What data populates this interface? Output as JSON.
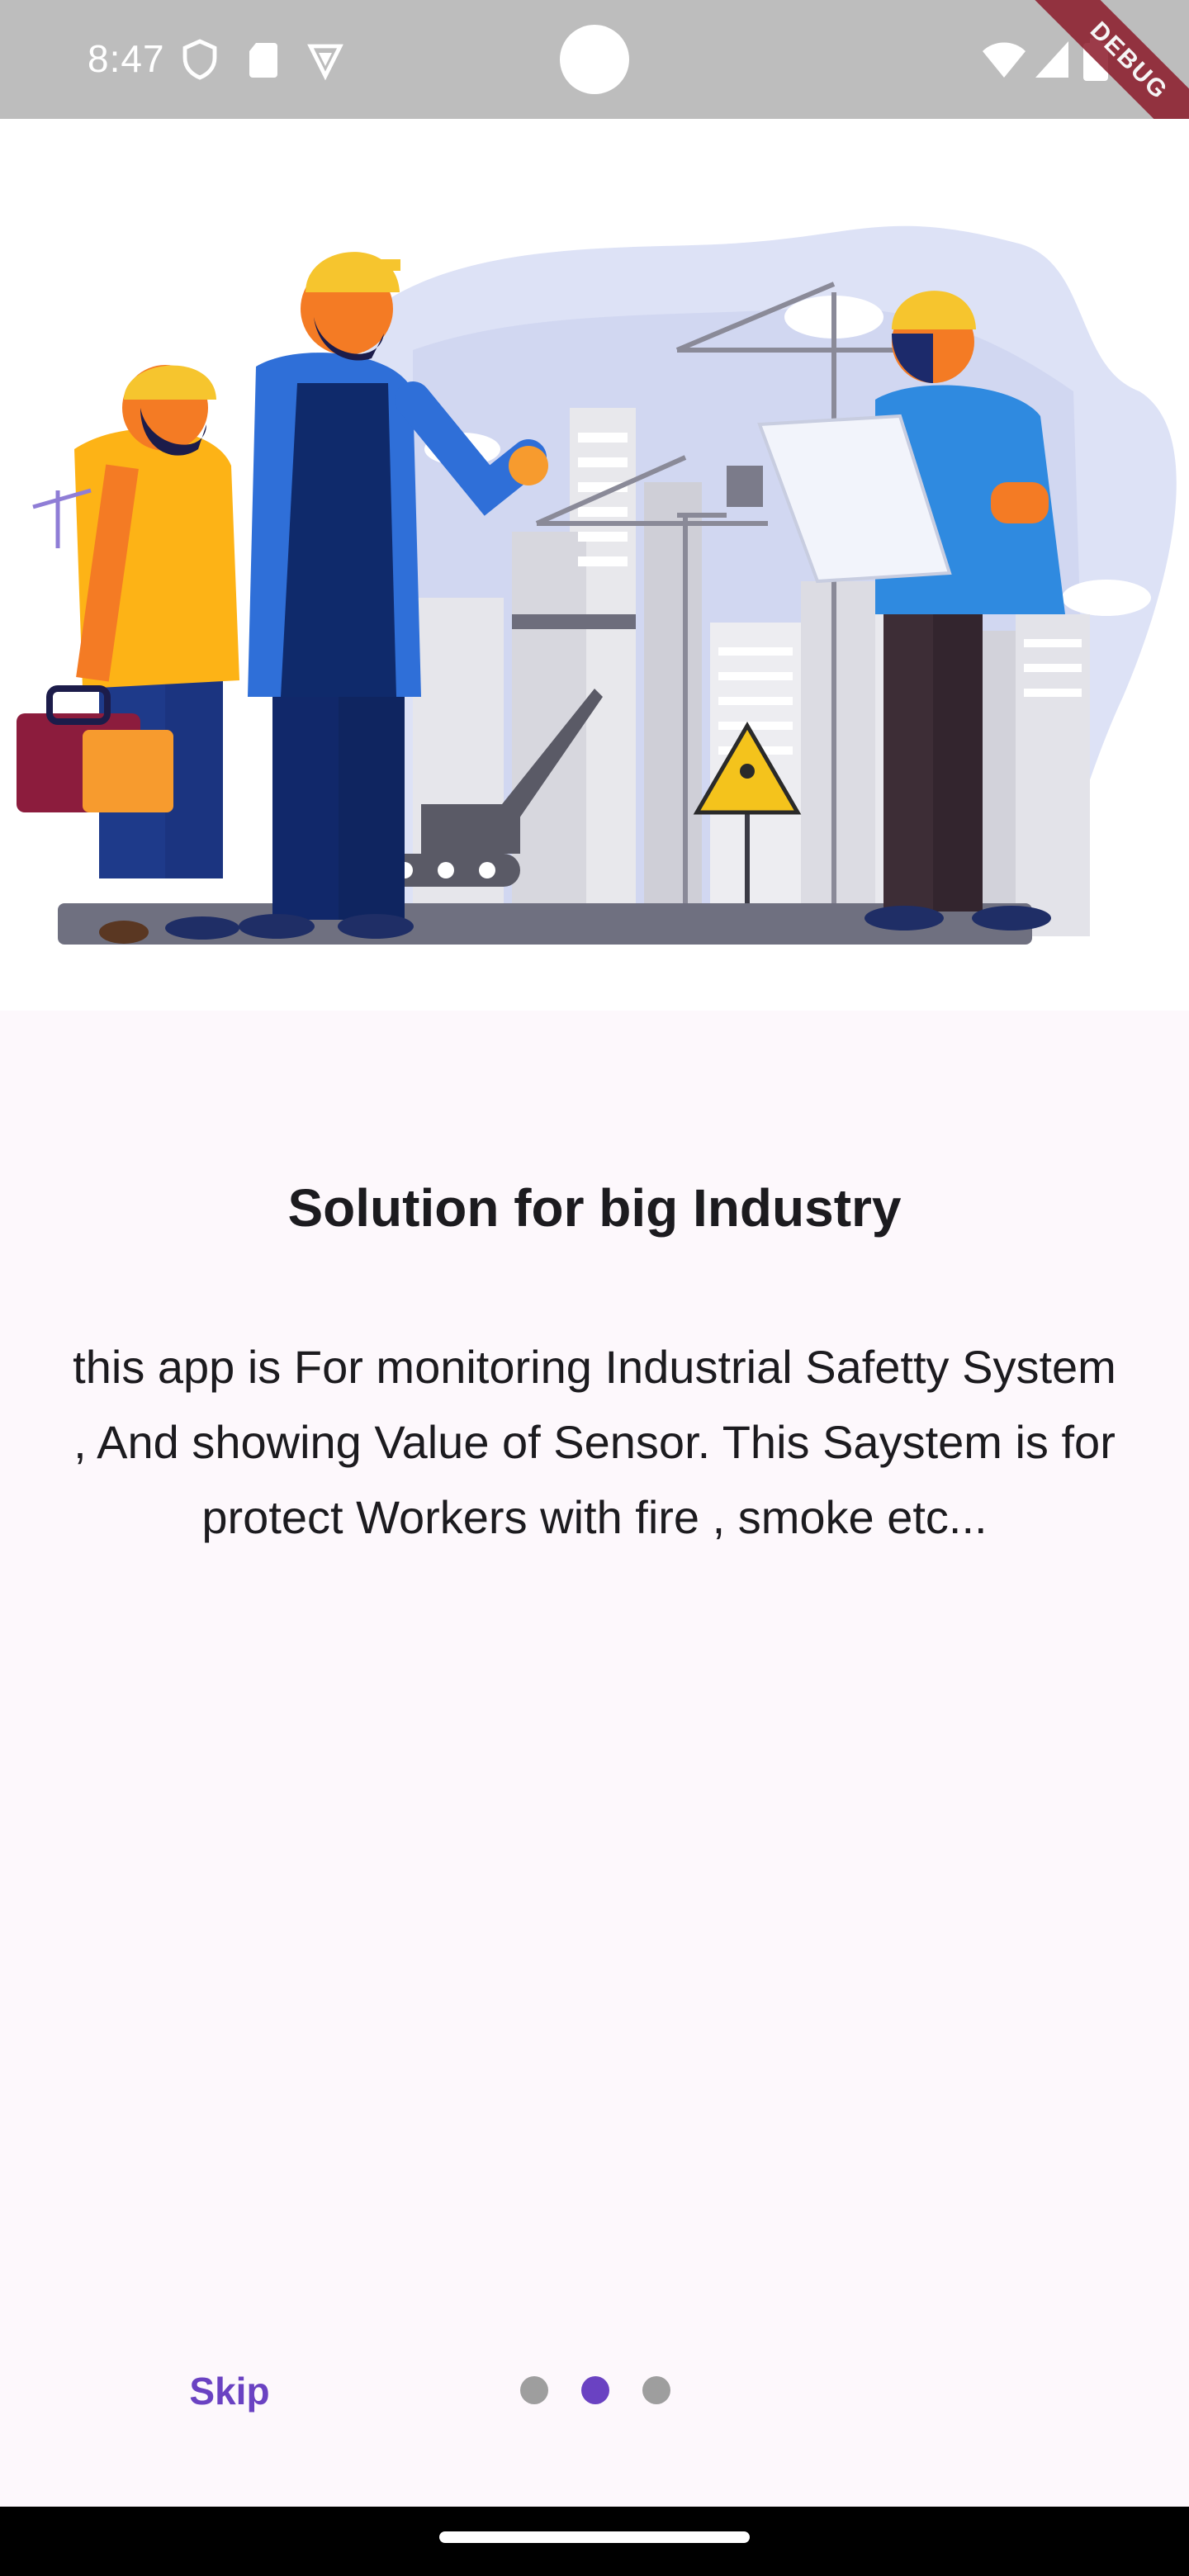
{
  "status_bar": {
    "time": "8:47",
    "icons_left": [
      "shield-icon",
      "sd-card-icon",
      "vpn-icon"
    ],
    "icons_right": [
      "wifi-icon",
      "cell-signal-icon",
      "battery-icon"
    ],
    "debug_label": "DEBUG",
    "background": "#bdbdbd"
  },
  "onboarding": {
    "illustration": "construction-workers-illustration",
    "title": "Solution for big Industry",
    "description": "this app is For monitoring  Industrial Safetty System , And showing Value of Sensor. This Saystem is for protect Workers with fire , smoke etc...",
    "page_index": 1,
    "page_count": 3
  },
  "controls": {
    "skip_label": "Skip",
    "dots": [
      "inactive",
      "active",
      "inactive"
    ]
  },
  "colors": {
    "accent": "#6a42c2",
    "background": "#fdf8fc",
    "text": "#1c1b1f",
    "dot_inactive": "#9e9e9e",
    "debug_banner": "#8b1a2a"
  }
}
